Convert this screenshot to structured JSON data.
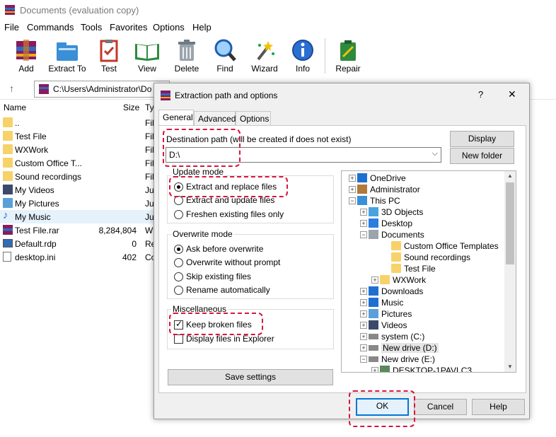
{
  "app": {
    "title": "Documents (evaluation copy)",
    "accent": "#0078d7",
    "highlight_color": "#d6163f"
  },
  "menu": [
    "File",
    "Commands",
    "Tools",
    "Favorites",
    "Options",
    "Help"
  ],
  "toolbar": [
    {
      "label": "Add",
      "icon": "add-archive-icon"
    },
    {
      "label": "Extract To",
      "icon": "extract-to-icon"
    },
    {
      "label": "Test",
      "icon": "test-icon"
    },
    {
      "label": "View",
      "icon": "view-book-icon"
    },
    {
      "label": "Delete",
      "icon": "trash-icon"
    },
    {
      "label": "Find",
      "icon": "magnifier-icon"
    },
    {
      "label": "Wizard",
      "icon": "wizard-wand-icon"
    },
    {
      "label": "Info",
      "icon": "info-icon"
    },
    {
      "label": "Repair",
      "icon": "repair-kit-icon"
    }
  ],
  "address": {
    "path": "C:\\Users\\Administrator\\Do"
  },
  "file_list": {
    "columns": {
      "name": "Name",
      "size": "Size",
      "type": "Ty"
    },
    "rows": [
      {
        "name": "..",
        "size": "",
        "type": "Fil",
        "icon": "folder-icon"
      },
      {
        "name": "Test File",
        "size": "",
        "type": "Fil",
        "icon": "folder-icon"
      },
      {
        "name": "WXWork",
        "size": "",
        "type": "Fil",
        "icon": "folder-icon"
      },
      {
        "name": "Custom Office T...",
        "size": "",
        "type": "Fil",
        "icon": "folder-icon"
      },
      {
        "name": "Sound recordings",
        "size": "",
        "type": "Fil",
        "icon": "folder-icon"
      },
      {
        "name": "My Videos",
        "size": "",
        "type": "Ju",
        "icon": "video-folder-icon"
      },
      {
        "name": "My Pictures",
        "size": "",
        "type": "Ju",
        "icon": "pictures-folder-icon"
      },
      {
        "name": "My Music",
        "size": "",
        "type": "Ju",
        "icon": "music-note-icon"
      },
      {
        "name": "Test File.rar",
        "size": "8,284,804",
        "type": "W",
        "icon": "rar-archive-icon"
      },
      {
        "name": "Default.rdp",
        "size": "0",
        "type": "Re",
        "icon": "rdp-file-icon"
      },
      {
        "name": "desktop.ini",
        "size": "402",
        "type": "Co",
        "icon": "ini-file-icon"
      }
    ]
  },
  "dialog": {
    "title": "Extraction path and options",
    "help_label": "?",
    "close_label": "✕",
    "tabs": [
      "General",
      "Advanced",
      "Options"
    ],
    "dest_label": "Destination path (will be created if does not exist)",
    "dest_value": "D:\\",
    "display_button": "Display",
    "new_folder_button": "New folder",
    "update_mode": {
      "title": "Update mode",
      "options": [
        "Extract and replace files",
        "Extract and update files",
        "Freshen existing files only"
      ],
      "selected": 0
    },
    "overwrite_mode": {
      "title": "Overwrite mode",
      "options": [
        "Ask before overwrite",
        "Overwrite without prompt",
        "Skip existing files",
        "Rename automatically"
      ],
      "selected": 0
    },
    "misc": {
      "title": "Miscellaneous",
      "options": [
        {
          "label": "Keep broken files",
          "checked": true
        },
        {
          "label": "Display files in Explorer",
          "checked": false
        }
      ]
    },
    "save_settings": "Save settings",
    "tree": [
      {
        "label": "OneDrive",
        "icon": "cloud-icon",
        "expander": "+"
      },
      {
        "label": "Administrator",
        "icon": "user-icon",
        "expander": "+"
      },
      {
        "label": "This PC",
        "icon": "computer-icon",
        "expander": "−"
      },
      {
        "label": "3D Objects",
        "icon": "3d-objects-icon",
        "expander": "+"
      },
      {
        "label": "Desktop",
        "icon": "desktop-icon",
        "expander": "+"
      },
      {
        "label": "Documents",
        "icon": "documents-icon",
        "expander": "−"
      },
      {
        "label": "Custom Office Templates",
        "icon": "folder-icon",
        "expander": ""
      },
      {
        "label": "Sound recordings",
        "icon": "folder-icon",
        "expander": ""
      },
      {
        "label": "Test File",
        "icon": "folder-icon",
        "expander": ""
      },
      {
        "label": "WXWork",
        "icon": "folder-icon",
        "expander": "+"
      },
      {
        "label": "Downloads",
        "icon": "download-icon",
        "expander": "+"
      },
      {
        "label": "Music",
        "icon": "music-note-icon",
        "expander": "+"
      },
      {
        "label": "Pictures",
        "icon": "pictures-folder-icon",
        "expander": "+"
      },
      {
        "label": "Videos",
        "icon": "video-folder-icon",
        "expander": "+"
      },
      {
        "label": "system (C:)",
        "icon": "drive-icon",
        "expander": "+"
      },
      {
        "label": "New drive (D:)",
        "icon": "drive-icon",
        "expander": "+"
      },
      {
        "label": "New drive (E:)",
        "icon": "drive-icon",
        "expander": "−"
      },
      {
        "label": "DESKTOP-1PAVLC3",
        "icon": "network-computer-icon",
        "expander": "+"
      }
    ],
    "ok": "OK",
    "cancel": "Cancel",
    "help": "Help"
  }
}
